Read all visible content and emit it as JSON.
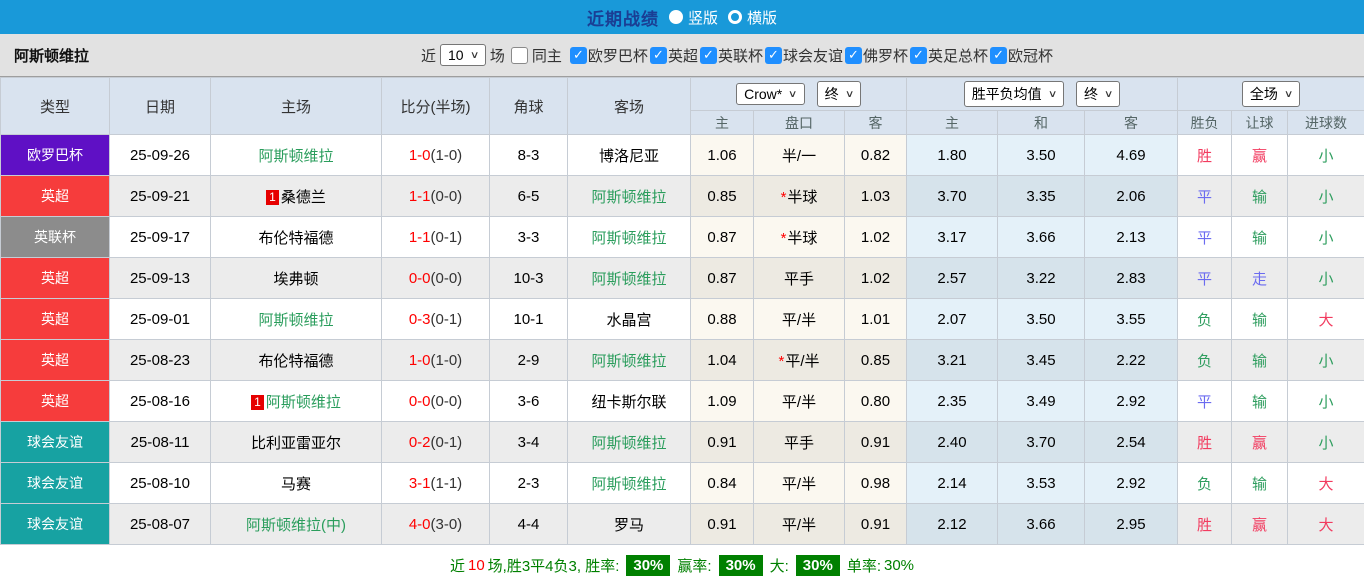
{
  "title_bar": {
    "title": "近期战绩",
    "radio_options": [
      {
        "label": "竖版",
        "selected": true
      },
      {
        "label": "横版",
        "selected": false
      }
    ]
  },
  "filter_bar": {
    "team_name": "阿斯顿维拉",
    "recent_label": "近",
    "recent_count": "10",
    "games_label": "场",
    "same_home_label": "同主",
    "same_home_checked": false,
    "competitions": [
      {
        "label": "欧罗巴杯",
        "checked": true
      },
      {
        "label": "英超",
        "checked": true
      },
      {
        "label": "英联杯",
        "checked": true
      },
      {
        "label": "球会友谊",
        "checked": true
      },
      {
        "label": "佛罗杯",
        "checked": true
      },
      {
        "label": "英足总杯",
        "checked": true
      },
      {
        "label": "欧冠杯",
        "checked": true
      }
    ]
  },
  "table": {
    "columns": [
      "类型",
      "日期",
      "主场",
      "比分(半场)",
      "角球",
      "客场"
    ],
    "dropdowns": {
      "company": "Crow*",
      "company_state": "终",
      "avg": "胜平负均值",
      "avg_state": "终",
      "full_match": "全场"
    },
    "sub_columns": [
      "主",
      "盘口",
      "客",
      "主",
      "和",
      "客",
      "胜负",
      "让球",
      "进球数"
    ],
    "colors": {
      "score_red": "#ff0000",
      "team_green": "#2a9d5c",
      "status_red": "#f23b5f",
      "status_blue": "#6b6bf0",
      "status_green": "#2f9e5f",
      "type_europa": "#5f10c5",
      "type_epl": "#f63c3c",
      "type_efl": "#8c8c8c",
      "type_friendly": "#17a2a2",
      "badge_red": "#e60000"
    },
    "rows": [
      {
        "type": "欧罗巴杯",
        "type_color": "#5f10c5",
        "date": "25-09-26",
        "home": "阿斯顿维拉",
        "home_green": true,
        "home_badge": "",
        "score": "1-0",
        "half": "(1-0)",
        "corner": "8-3",
        "away": "博洛尼亚",
        "away_green": false,
        "odds_home": "1.06",
        "handicap": "半/一",
        "handicap_star": false,
        "odds_away": "0.82",
        "avg_home": "1.80",
        "avg_draw": "3.50",
        "avg_away": "4.69",
        "result": "胜",
        "result_color": "red",
        "handicap_result": "赢",
        "handicap_result_color": "red",
        "goals": "小",
        "goals_color": "green"
      },
      {
        "type": "英超",
        "type_color": "#f63c3c",
        "date": "25-09-21",
        "home": "桑德兰",
        "home_green": false,
        "home_badge": "1",
        "score": "1-1",
        "half": "(0-0)",
        "corner": "6-5",
        "away": "阿斯顿维拉",
        "away_green": true,
        "odds_home": "0.85",
        "handicap": "半球",
        "handicap_star": true,
        "odds_away": "1.03",
        "avg_home": "3.70",
        "avg_draw": "3.35",
        "avg_away": "2.06",
        "result": "平",
        "result_color": "blue",
        "handicap_result": "输",
        "handicap_result_color": "green",
        "goals": "小",
        "goals_color": "green"
      },
      {
        "type": "英联杯",
        "type_color": "#8c8c8c",
        "date": "25-09-17",
        "home": "布伦特福德",
        "home_green": false,
        "home_badge": "",
        "score": "1-1",
        "half": "(0-1)",
        "corner": "3-3",
        "away": "阿斯顿维拉",
        "away_green": true,
        "odds_home": "0.87",
        "handicap": "半球",
        "handicap_star": true,
        "odds_away": "1.02",
        "avg_home": "3.17",
        "avg_draw": "3.66",
        "avg_away": "2.13",
        "result": "平",
        "result_color": "blue",
        "handicap_result": "输",
        "handicap_result_color": "green",
        "goals": "小",
        "goals_color": "green"
      },
      {
        "type": "英超",
        "type_color": "#f63c3c",
        "date": "25-09-13",
        "home": "埃弗顿",
        "home_green": false,
        "home_badge": "",
        "score": "0-0",
        "half": "(0-0)",
        "corner": "10-3",
        "away": "阿斯顿维拉",
        "away_green": true,
        "odds_home": "0.87",
        "handicap": "平手",
        "handicap_star": false,
        "odds_away": "1.02",
        "avg_home": "2.57",
        "avg_draw": "3.22",
        "avg_away": "2.83",
        "result": "平",
        "result_color": "blue",
        "handicap_result": "走",
        "handicap_result_color": "blue",
        "goals": "小",
        "goals_color": "green"
      },
      {
        "type": "英超",
        "type_color": "#f63c3c",
        "date": "25-09-01",
        "home": "阿斯顿维拉",
        "home_green": true,
        "home_badge": "",
        "score": "0-3",
        "half": "(0-1)",
        "corner": "10-1",
        "away": "水晶宫",
        "away_green": false,
        "odds_home": "0.88",
        "handicap": "平/半",
        "handicap_star": false,
        "odds_away": "1.01",
        "avg_home": "2.07",
        "avg_draw": "3.50",
        "avg_away": "3.55",
        "result": "负",
        "result_color": "green",
        "handicap_result": "输",
        "handicap_result_color": "green",
        "goals": "大",
        "goals_color": "red"
      },
      {
        "type": "英超",
        "type_color": "#f63c3c",
        "date": "25-08-23",
        "home": "布伦特福德",
        "home_green": false,
        "home_badge": "",
        "score": "1-0",
        "half": "(1-0)",
        "corner": "2-9",
        "away": "阿斯顿维拉",
        "away_green": true,
        "odds_home": "1.04",
        "handicap": "平/半",
        "handicap_star": true,
        "odds_away": "0.85",
        "avg_home": "3.21",
        "avg_draw": "3.45",
        "avg_away": "2.22",
        "result": "负",
        "result_color": "green",
        "handicap_result": "输",
        "handicap_result_color": "green",
        "goals": "小",
        "goals_color": "green"
      },
      {
        "type": "英超",
        "type_color": "#f63c3c",
        "date": "25-08-16",
        "home": "阿斯顿维拉",
        "home_green": true,
        "home_badge": "1",
        "score": "0-0",
        "half": "(0-0)",
        "corner": "3-6",
        "away": "纽卡斯尔联",
        "away_green": false,
        "odds_home": "1.09",
        "handicap": "平/半",
        "handicap_star": false,
        "odds_away": "0.80",
        "avg_home": "2.35",
        "avg_draw": "3.49",
        "avg_away": "2.92",
        "result": "平",
        "result_color": "blue",
        "handicap_result": "输",
        "handicap_result_color": "green",
        "goals": "小",
        "goals_color": "green"
      },
      {
        "type": "球会友谊",
        "type_color": "#17a2a2",
        "date": "25-08-11",
        "home": "比利亚雷亚尔",
        "home_green": false,
        "home_badge": "",
        "score": "0-2",
        "half": "(0-1)",
        "corner": "3-4",
        "away": "阿斯顿维拉",
        "away_green": true,
        "odds_home": "0.91",
        "handicap": "平手",
        "handicap_star": false,
        "odds_away": "0.91",
        "avg_home": "2.40",
        "avg_draw": "3.70",
        "avg_away": "2.54",
        "result": "胜",
        "result_color": "red",
        "handicap_result": "赢",
        "handicap_result_color": "red",
        "goals": "小",
        "goals_color": "green"
      },
      {
        "type": "球会友谊",
        "type_color": "#17a2a2",
        "date": "25-08-10",
        "home": "马赛",
        "home_green": false,
        "home_badge": "",
        "score": "3-1",
        "half": "(1-1)",
        "corner": "2-3",
        "away": "阿斯顿维拉",
        "away_green": true,
        "odds_home": "0.84",
        "handicap": "平/半",
        "handicap_star": false,
        "odds_away": "0.98",
        "avg_home": "2.14",
        "avg_draw": "3.53",
        "avg_away": "2.92",
        "result": "负",
        "result_color": "green",
        "handicap_result": "输",
        "handicap_result_color": "green",
        "goals": "大",
        "goals_color": "red"
      },
      {
        "type": "球会友谊",
        "type_color": "#17a2a2",
        "date": "25-08-07",
        "home": "阿斯顿维拉(中)",
        "home_green": true,
        "home_badge": "",
        "score": "4-0",
        "half": "(3-0)",
        "corner": "4-4",
        "away": "罗马",
        "away_green": false,
        "odds_home": "0.91",
        "handicap": "平/半",
        "handicap_star": false,
        "odds_away": "0.91",
        "avg_home": "2.12",
        "avg_draw": "3.66",
        "avg_away": "2.95",
        "result": "胜",
        "result_color": "red",
        "handicap_result": "赢",
        "handicap_result_color": "red",
        "goals": "大",
        "goals_color": "red"
      }
    ]
  },
  "footer": {
    "prefix": "近",
    "count": "10",
    "summary": "场,胜3平4负3, 胜率:",
    "win_rate": "30%",
    "handicap_label": "赢率:",
    "handicap_rate": "30%",
    "big_label": "大:",
    "big_rate": "30%",
    "single_label": "单率:",
    "single_rate": "30%"
  }
}
